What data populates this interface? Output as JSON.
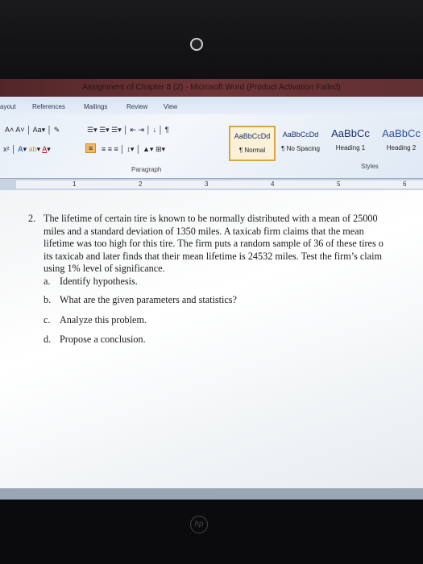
{
  "window": {
    "title": "Assignment of Chapter 8 (2) - Microsoft Word (Product Activation Failed)"
  },
  "tabs": [
    "ayout",
    "References",
    "Mailings",
    "Review",
    "View"
  ],
  "ribbon": {
    "groups": [
      "Paragraph",
      "Styles"
    ],
    "styles": [
      {
        "preview": "AaBbCcDd",
        "label": "¶ Normal",
        "selected": true
      },
      {
        "preview": "AaBbCcDd",
        "label": "¶ No Spacing",
        "selected": false
      },
      {
        "preview": "AaBbCc",
        "label": "Heading 1",
        "selected": false
      },
      {
        "preview": "AaBbCc",
        "label": "Heading 2",
        "selected": false
      }
    ]
  },
  "ruler": [
    "1",
    "2",
    "3",
    "4",
    "5",
    "6"
  ],
  "document": {
    "number": "2.",
    "lines": [
      "The lifetime of certain tire is known to be normally distributed with a mean of 25000",
      "miles and a standard deviation of 1350 miles. A taxicab firm claims that the mean",
      "lifetime was too high for this tire. The firm puts a random sample of 36 of these tires o",
      "its taxicab and later finds that their mean lifetime is 24532 miles. Test the firm’s claim",
      "using 1% level of significance."
    ],
    "parts": [
      {
        "letter": "a.",
        "text": "Identify hypothesis."
      },
      {
        "letter": "b.",
        "text": "What are the given parameters and statistics?"
      },
      {
        "letter": "c.",
        "text": "Analyze this problem."
      },
      {
        "letter": "d.",
        "text": "Propose a conclusion."
      }
    ]
  },
  "brand": {
    "logo": "hp"
  }
}
